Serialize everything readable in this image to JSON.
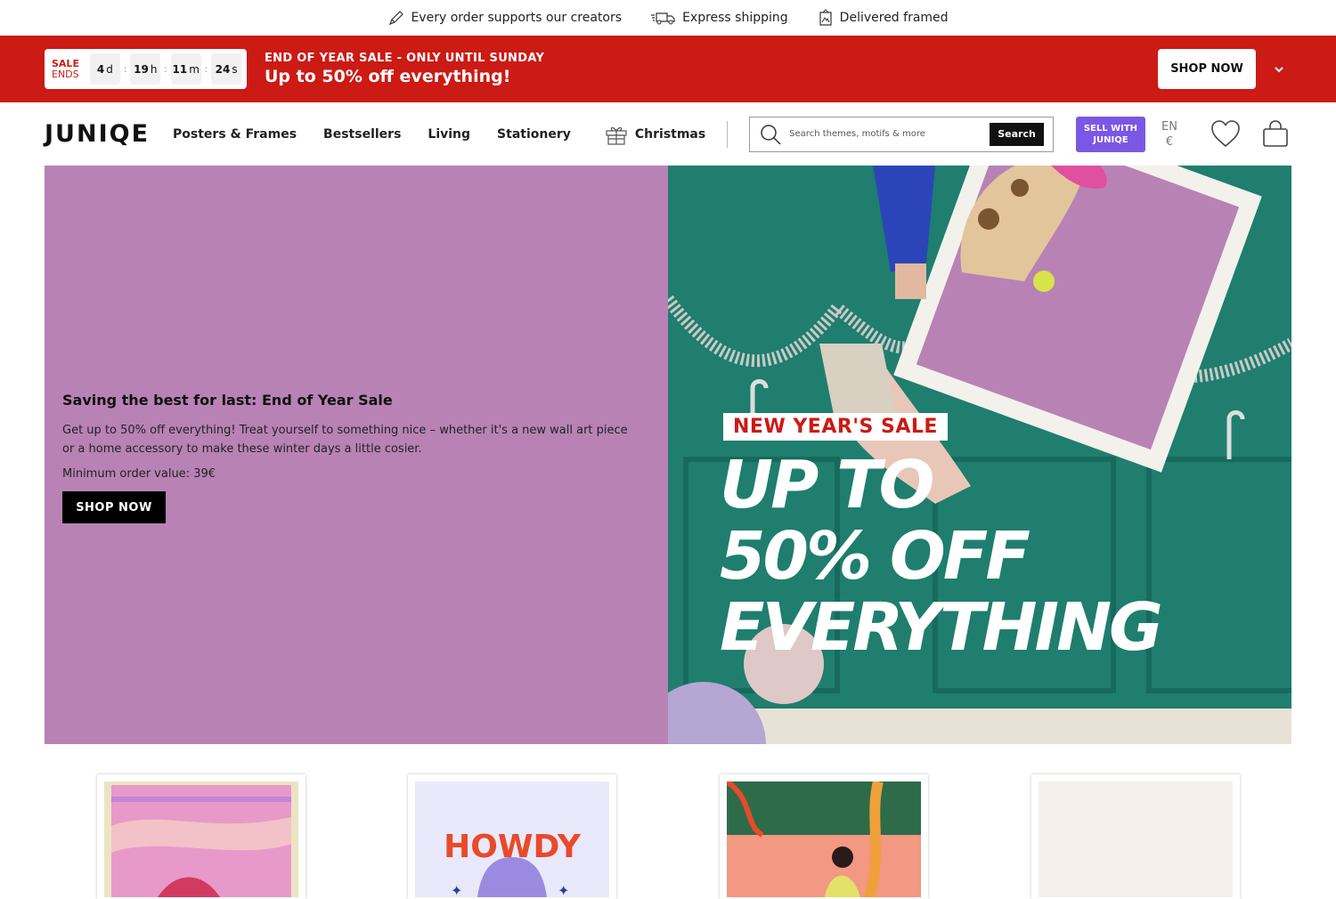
{
  "usp": [
    {
      "icon": "pencil-icon",
      "text": "Every order supports our creators"
    },
    {
      "icon": "truck-icon",
      "text": "Express shipping"
    },
    {
      "icon": "frame-icon",
      "text": "Delivered framed"
    }
  ],
  "sale_banner": {
    "label_line1": "SALE",
    "label_line2": "ENDS",
    "countdown": [
      {
        "value": "4",
        "unit": "d"
      },
      {
        "value": "19",
        "unit": "h"
      },
      {
        "value": "11",
        "unit": "m"
      },
      {
        "value": "24",
        "unit": "s"
      }
    ],
    "headline": "END OF YEAR SALE - ONLY UNTIL SUNDAY",
    "subline": "Up to 50% off everything!",
    "button": "SHOP NOW",
    "background": "#cc1a15"
  },
  "header": {
    "logo": "JUNIQE",
    "nav": [
      "Posters & Frames",
      "Bestsellers",
      "Living",
      "Stationery"
    ],
    "christmas": "Christmas",
    "search_placeholder": "Search themes, motifs & more",
    "search_button": "Search",
    "sell_line1": "SELL WITH",
    "sell_line2": "JUNIQE",
    "sell_color": "#7b57e5",
    "language": "EN",
    "currency": "€"
  },
  "hero": {
    "title": "Saving the best for last: End of Year Sale",
    "description": "Get up to 50% off everything! Treat yourself to something nice – whether it's a new wall art piece or a home accessory to make these winter days a little cosier.",
    "minimum": "Minimum order value: 39€",
    "button": "SHOP NOW",
    "bg_color": "#b882b5",
    "promo_tag": "NEW YEAR'S SALE",
    "promo_line1": "UP TO",
    "promo_line2": "50% OFF",
    "promo_line3": "EVERYTHING"
  },
  "products": [
    {
      "name": "pink-landscape-print"
    },
    {
      "name": "howdy-print",
      "text": "HOWDY"
    },
    {
      "name": "illustrated-woman-print"
    },
    {
      "name": "beige-print"
    }
  ]
}
